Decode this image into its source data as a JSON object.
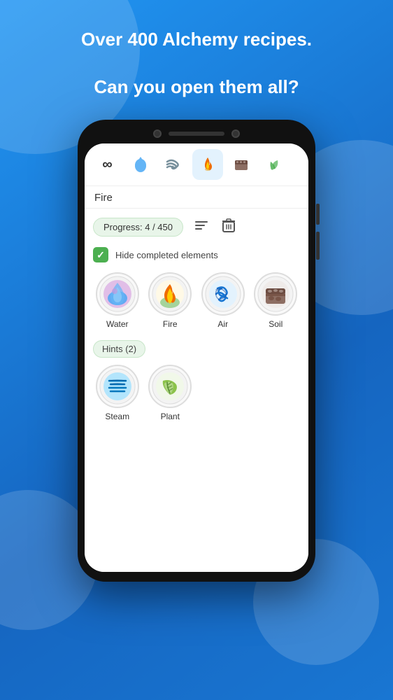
{
  "background": {
    "gradient_start": "#2196f3",
    "gradient_end": "#1565c0"
  },
  "headline": {
    "line1": "Over 400 Alchemy recipes.",
    "line2": "Can you open them all?"
  },
  "tabs": [
    {
      "id": "infinity",
      "icon": "∞",
      "label": "Infinity",
      "active": false
    },
    {
      "id": "water",
      "icon": "💧",
      "label": "Water",
      "active": false
    },
    {
      "id": "wind",
      "icon": "💨",
      "label": "Wind",
      "active": false
    },
    {
      "id": "fire",
      "icon": "🔥",
      "label": "Fire",
      "active": true
    },
    {
      "id": "soil",
      "icon": "🪨",
      "label": "Soil",
      "active": false
    },
    {
      "id": "plant",
      "icon": "🌿",
      "label": "Plant",
      "active": false
    }
  ],
  "selected_element": "Fire",
  "progress": {
    "label": "Progress: 4 / 450",
    "current": 4,
    "total": 450
  },
  "toolbar": {
    "sort_icon": "≡",
    "delete_icon": "🗑"
  },
  "checkbox": {
    "checked": true,
    "label": "Hide completed elements"
  },
  "elements": [
    {
      "id": "water",
      "name": "Water",
      "emoji": "water"
    },
    {
      "id": "fire",
      "name": "Fire",
      "emoji": "fire"
    },
    {
      "id": "air",
      "name": "Air",
      "emoji": "air"
    },
    {
      "id": "soil",
      "name": "Soil",
      "emoji": "soil"
    }
  ],
  "hints_section": {
    "label": "Hints (2)",
    "items": [
      {
        "id": "steam",
        "name": "Steam",
        "emoji": "steam"
      },
      {
        "id": "plant",
        "name": "Plant",
        "emoji": "plant"
      }
    ]
  }
}
